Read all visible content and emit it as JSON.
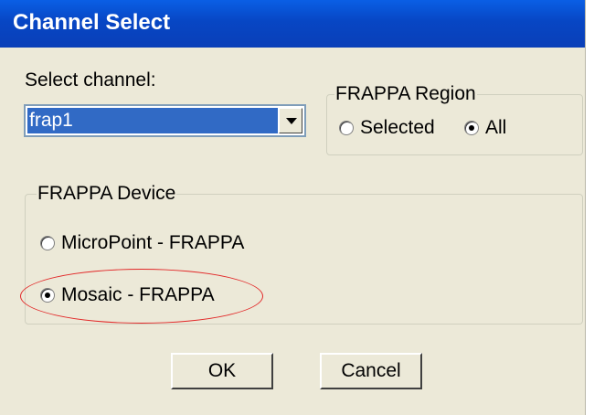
{
  "window": {
    "title": "Channel Select"
  },
  "channel": {
    "label": "Select channel:",
    "selected": "frap1"
  },
  "region": {
    "legend": "FRAPPA Region",
    "options": [
      {
        "label": "Selected",
        "checked": false
      },
      {
        "label": "All",
        "checked": true
      }
    ]
  },
  "device": {
    "legend": "FRAPPA Device",
    "options": [
      {
        "label": "MicroPoint - FRAPPA",
        "checked": false
      },
      {
        "label": "Mosaic - FRAPPA",
        "checked": true
      }
    ]
  },
  "buttons": {
    "ok": "OK",
    "cancel": "Cancel"
  },
  "annotation": {
    "color": "#e22828"
  }
}
